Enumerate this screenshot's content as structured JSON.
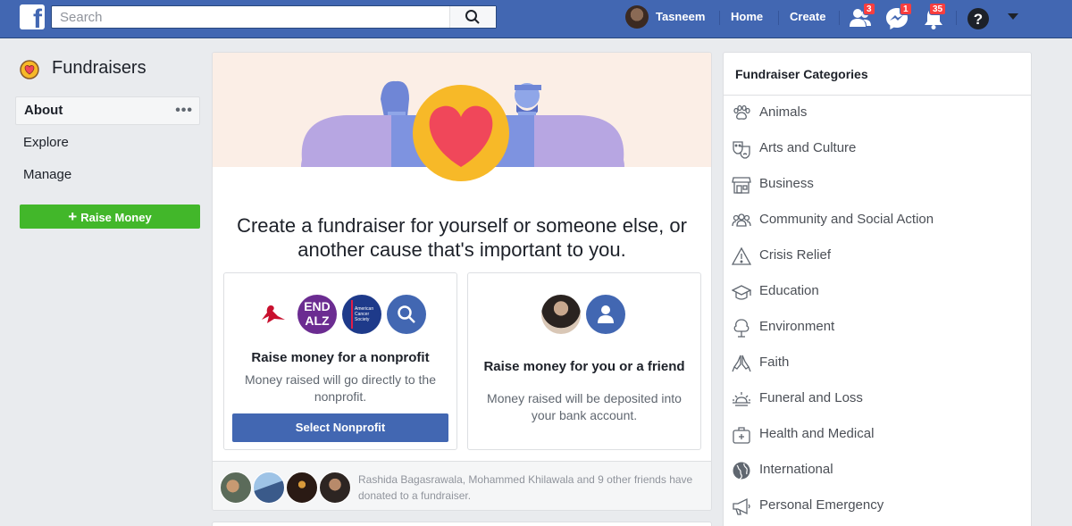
{
  "topbar": {
    "logo_icon": "facebook-logo",
    "search_placeholder": "Search",
    "profile_name": "Tasneem",
    "home": "Home",
    "create": "Create",
    "friend_requests_count": "3",
    "messages_count": "1",
    "notifications_count": "35"
  },
  "sidebar": {
    "title": "Fundraisers",
    "items": [
      {
        "label": "About",
        "active": true
      },
      {
        "label": "Explore",
        "active": false
      },
      {
        "label": "Manage",
        "active": false
      }
    ],
    "more_dots": "•••",
    "raise_button": "Raise Money"
  },
  "main": {
    "heading": "Create a fundraiser for yourself or someone else, or another cause that's important to you.",
    "nonprofit_card": {
      "logo_end": "END",
      "logo_alz": "ALZ",
      "logo_acs": "American Cancer Society",
      "title": "Raise money for a nonprofit",
      "description": "Money raised will go directly to the nonprofit.",
      "button": "Select Nonprofit"
    },
    "personal_card": {
      "title": "Raise money for you or a friend",
      "description": "Money raised will be deposited into your bank account."
    },
    "friends_text": "Rashida Bagasrawala, Mohammed Khilawala and 9 other friends have donated to a fundraiser."
  },
  "categories": {
    "title": "Fundraiser Categories",
    "items": [
      {
        "label": "Animals",
        "icon": "paw-icon"
      },
      {
        "label": "Arts and Culture",
        "icon": "theater-masks-icon"
      },
      {
        "label": "Business",
        "icon": "storefront-icon"
      },
      {
        "label": "Community and Social Action",
        "icon": "people-group-icon"
      },
      {
        "label": "Crisis Relief",
        "icon": "warning-triangle-icon"
      },
      {
        "label": "Education",
        "icon": "graduation-cap-icon"
      },
      {
        "label": "Environment",
        "icon": "tree-icon"
      },
      {
        "label": "Faith",
        "icon": "praying-hands-icon"
      },
      {
        "label": "Funeral and Loss",
        "icon": "sunset-icon"
      },
      {
        "label": "Health and Medical",
        "icon": "medical-kit-icon"
      },
      {
        "label": "International",
        "icon": "globe-icon"
      },
      {
        "label": "Personal Emergency",
        "icon": "megaphone-icon"
      }
    ]
  },
  "colors": {
    "brand_blue": "#4267b2",
    "green": "#42b72a",
    "heart_red": "#f0475a",
    "heart_yellow": "#f7b928",
    "purple": "#b7a6e2",
    "badge_red": "#fa3e3e"
  }
}
